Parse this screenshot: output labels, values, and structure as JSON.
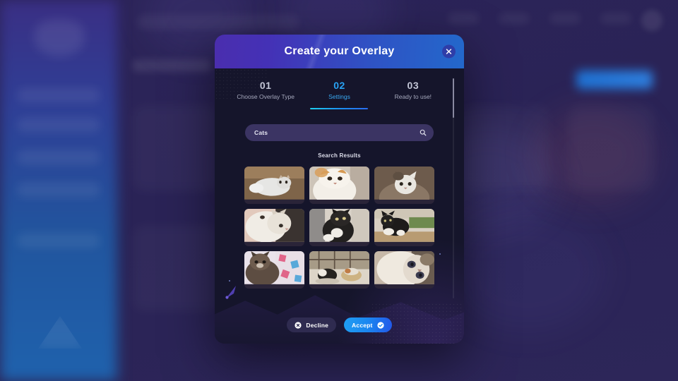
{
  "modal": {
    "title": "Create your Overlay",
    "close_icon": "close-icon",
    "steps": [
      {
        "number": "01",
        "label": "Choose Overlay Type",
        "active": false
      },
      {
        "number": "02",
        "label": "Settings",
        "active": true
      },
      {
        "number": "03",
        "label": "Ready to use!",
        "active": false
      }
    ],
    "search": {
      "value": "Cats",
      "placeholder": "Search",
      "icon": "search-icon"
    },
    "results_title": "Search Results",
    "results": [
      {
        "alt": "white cat lying on wooden floor"
      },
      {
        "alt": "orange and white cat looking up close"
      },
      {
        "alt": "grey and white cat on brown background"
      },
      {
        "alt": "white cat face close up on pink blanket"
      },
      {
        "alt": "black and white kitten being held"
      },
      {
        "alt": "tuxedo cat sitting on green rug"
      },
      {
        "alt": "fluffy kitten on floral blanket"
      },
      {
        "alt": "two cats sleeping in basket by window"
      },
      {
        "alt": "siamese cat close up portrait"
      }
    ],
    "footer": {
      "decline_label": "Decline",
      "decline_icon": "close-circle-icon",
      "accept_label": "Accept",
      "accept_icon": "check-circle-icon"
    }
  },
  "colors": {
    "header_gradient_start": "#4a2eae",
    "header_gradient_end": "#2368cb",
    "accent_active": "#28a3f5",
    "accept_gradient_start": "#1f9ef2",
    "accept_gradient_end": "#2358e8",
    "modal_body": "#15152b",
    "search_field": "#3b3463",
    "decline_button": "#2f2b50"
  }
}
